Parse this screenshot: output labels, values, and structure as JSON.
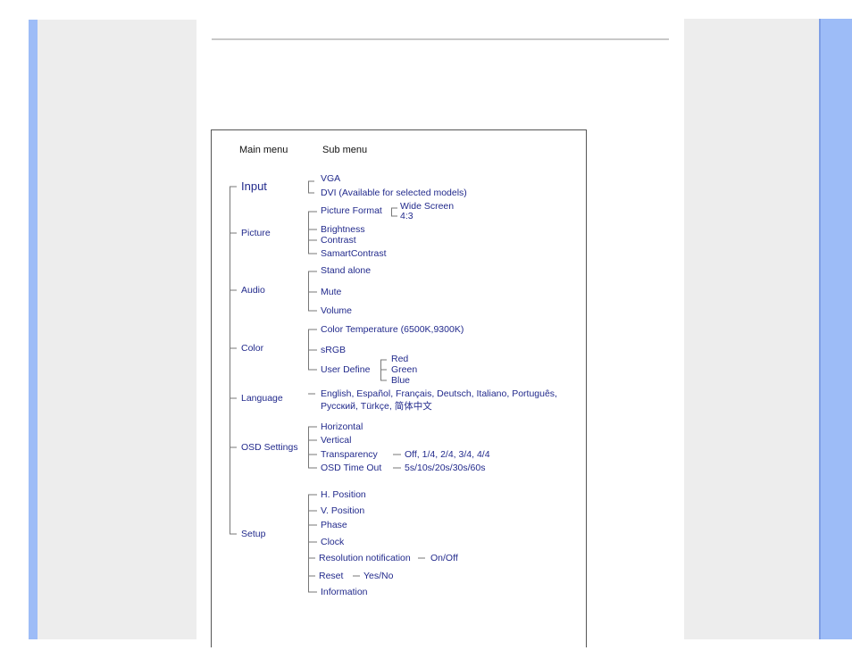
{
  "colors": {
    "accent_blue": "#9dbcf7",
    "side_gray": "#ededed",
    "diagram_text": "#222a8c"
  },
  "diagram": {
    "headers": {
      "main": "Main menu",
      "sub": "Sub menu"
    },
    "main": [
      "Input",
      "Picture",
      "Audio",
      "Color",
      "Language",
      "OSD Settings",
      "Setup"
    ],
    "input": [
      "VGA",
      "DVI (Available for selected models)"
    ],
    "picture": [
      "Picture Format",
      "Brightness",
      "Contrast",
      "SamartContrast"
    ],
    "picture_format": [
      "Wide Screen",
      "4:3"
    ],
    "audio": [
      "Stand alone",
      "Mute",
      "Volume"
    ],
    "color": [
      "Color Temperature (6500K,9300K)",
      "sRGB",
      "User Define"
    ],
    "user_define": [
      "Red",
      "Green",
      "Blue"
    ],
    "language": [
      "English, Español, Français, Deutsch, Italiano, Português,",
      "Русский, Türkçe, 简体中文"
    ],
    "osd": [
      "Horizontal",
      "Vertical",
      "Transparency",
      "OSD Time Out"
    ],
    "transparency_values": "Off, 1/4, 2/4, 3/4, 4/4",
    "timeout_values": "5s/10s/20s/30s/60s",
    "setup": [
      "H. Position",
      "V. Position",
      "Phase",
      "Clock",
      "Resolution notification",
      "Reset",
      "Information"
    ],
    "resolution_values": "On/Off",
    "reset_values": "Yes/No"
  }
}
